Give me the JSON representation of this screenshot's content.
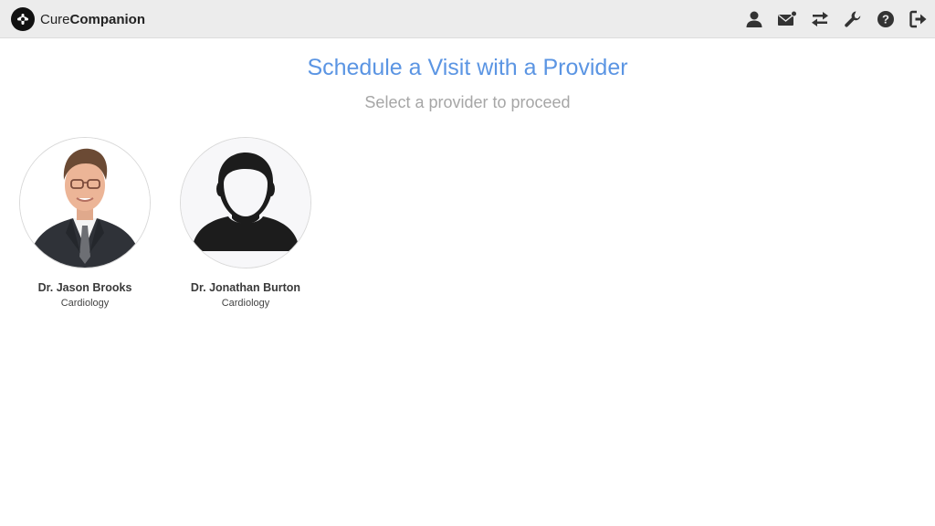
{
  "app": {
    "brand_prefix": "Cure",
    "brand_suffix": "Companion"
  },
  "nav": {
    "icons": [
      "user-icon",
      "mail-notification-icon",
      "transfer-icon",
      "wrench-icon",
      "help-icon",
      "logout-icon"
    ]
  },
  "page": {
    "title": "Schedule a Visit with a Provider",
    "subtitle": "Select a provider to proceed"
  },
  "providers": [
    {
      "name": "Dr. Jason Brooks",
      "specialty": "Cardiology",
      "photo": "provider-photo"
    },
    {
      "name": "Dr. Jonathan Burton",
      "specialty": "Cardiology",
      "photo": "placeholder-avatar-icon"
    }
  ],
  "colors": {
    "accent": "#5b95e3",
    "topbar": "#ececec",
    "subtitle": "#a6a6a6",
    "icon": "#333333"
  }
}
